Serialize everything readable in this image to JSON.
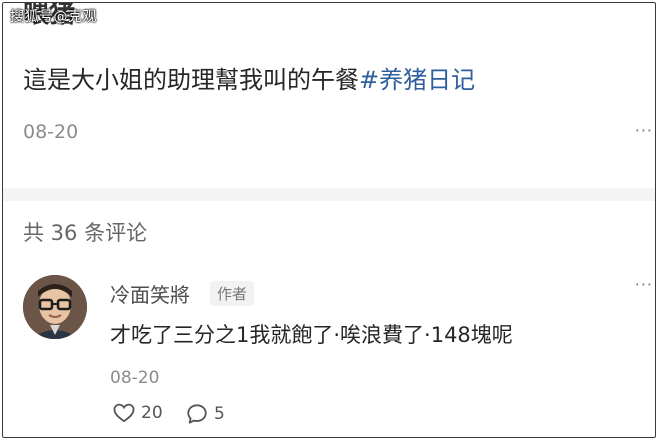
{
  "watermark": "搜狐号@克观",
  "post": {
    "title_partial": "喂猪",
    "text": "這是大小姐的助理幫我叫的午餐",
    "hashtag": "#养猪日记",
    "date": "08-20",
    "more_label": "···"
  },
  "comments": {
    "count_label": "共 36 条评论",
    "items": [
      {
        "author": "冷面笑將",
        "badge": "作者",
        "text": "才吃了三分之1我就飽了·唉浪費了·148塊呢",
        "date": "08-20",
        "likes": "20",
        "replies": "5",
        "more_label": "···"
      }
    ]
  },
  "colors": {
    "hashtag": "#2e5f9e",
    "muted": "#8c8c8c",
    "divider": "#f4f4f4"
  },
  "icons": {
    "avatar": "avatar-glasses-man",
    "like": "heart-icon",
    "reply": "comment-bubble-icon",
    "more": "ellipsis-icon"
  }
}
